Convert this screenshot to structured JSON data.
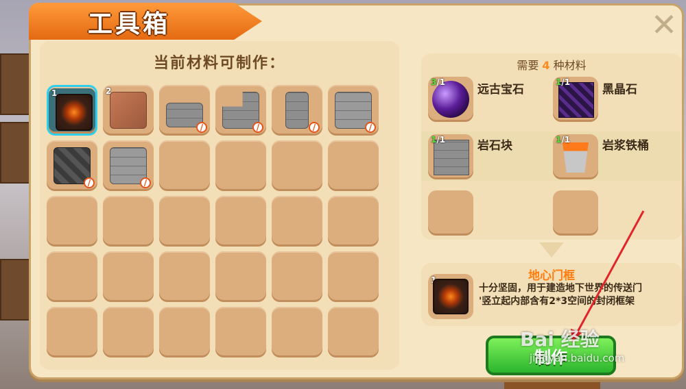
{
  "window": {
    "title": "工具箱",
    "close_icon": "close-icon"
  },
  "crafting": {
    "heading": "当前材料可制作："
  },
  "grid": {
    "rows": [
      [
        {
          "count": "1",
          "item": "portal-frame",
          "selected": true
        },
        {
          "count": "2",
          "item": "dirt-block"
        },
        {
          "count": "",
          "item": "stone-slab",
          "locked": true
        },
        {
          "count": "",
          "item": "stone-stairs",
          "locked": true
        },
        {
          "count": "",
          "item": "stone-pillar",
          "locked": true
        },
        {
          "count": "",
          "item": "stone-brick",
          "locked": true
        }
      ],
      [
        {
          "count": "",
          "item": "cobblestone",
          "locked": true
        },
        {
          "count": "",
          "item": "stone-brick-2",
          "locked": true
        },
        {},
        {},
        {},
        {}
      ],
      [
        {},
        {},
        {},
        {},
        {},
        {}
      ],
      [
        {},
        {},
        {},
        {},
        {},
        {}
      ],
      [
        {},
        {},
        {},
        {},
        {},
        {}
      ]
    ]
  },
  "requirements": {
    "prefix": "需要",
    "count": "4",
    "suffix": "种材料",
    "materials": [
      {
        "name": "远古宝石",
        "have": "3",
        "need": "1"
      },
      {
        "name": "黑晶石",
        "have": "1",
        "need": "1"
      },
      {
        "name": "岩石块",
        "have": "1",
        "need": "1"
      },
      {
        "name": "岩浆铁桶",
        "have": "1",
        "need": "1"
      }
    ]
  },
  "result": {
    "name": "地心门框",
    "count": "1",
    "description_line1": "十分坚固，用于建造地下世界的传送门",
    "description_line2": "'竖立起内部含有2*3空间的封闭框架"
  },
  "craft_button": {
    "label": "制作"
  },
  "watermark": {
    "main": "Bai  经验",
    "sub": "jingyan.baidu.com"
  },
  "colors": {
    "accent": "#ff8a1d",
    "panel": "#f6e6c3",
    "slot": "#dcae7e",
    "craft_green": "#2bb52d",
    "annotation_red": "#e0242a"
  }
}
